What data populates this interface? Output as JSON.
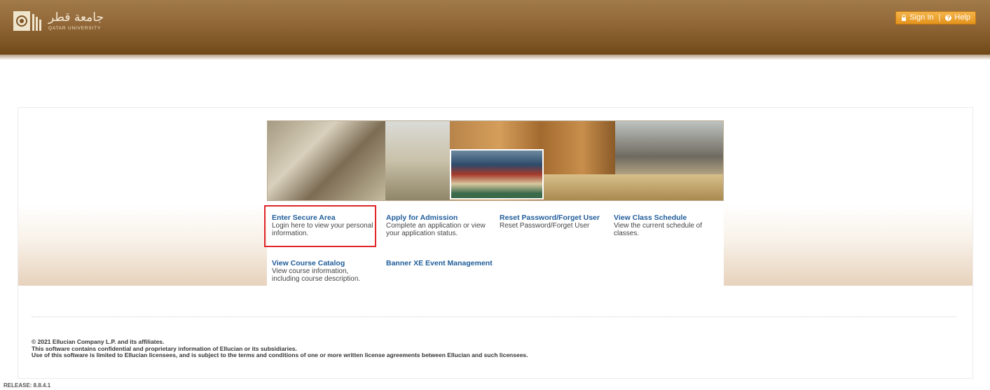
{
  "header": {
    "logo_arabic": "جامعة قطر",
    "logo_english": "QATAR UNIVERSITY",
    "sign_in": "Sign In",
    "separator": "|",
    "help": "Help"
  },
  "links": [
    {
      "title": "Enter Secure Area",
      "desc": "Login here to view your personal information."
    },
    {
      "title": "Apply for Admission",
      "desc": "Complete an application or view your application status."
    },
    {
      "title": "Reset Password/Forget User",
      "desc": "Reset Password/Forget User"
    },
    {
      "title": "View Class Schedule",
      "desc": "View the current schedule of classes."
    },
    {
      "title": "View Course Catalog",
      "desc": "View course information, including course description."
    },
    {
      "title": "Banner XE Event Management",
      "desc": ""
    }
  ],
  "footer": {
    "line1": "© 2021 Ellucian Company L.P. and its affiliates.",
    "line2": "This software contains confidential and proprietary information of Ellucian or its subsidiaries.",
    "line3": "Use of this software is limited to Ellucian licensees, and is subject to the terms and conditions of one or more written license agreements between Ellucian and such licensees."
  },
  "release": "RELEASE: 8.8.4.1",
  "colors": {
    "header_brown": "#93693a",
    "link_blue": "#1f5c9a",
    "signin_orange": "#e4941c",
    "highlight_red": "#e0262a"
  }
}
